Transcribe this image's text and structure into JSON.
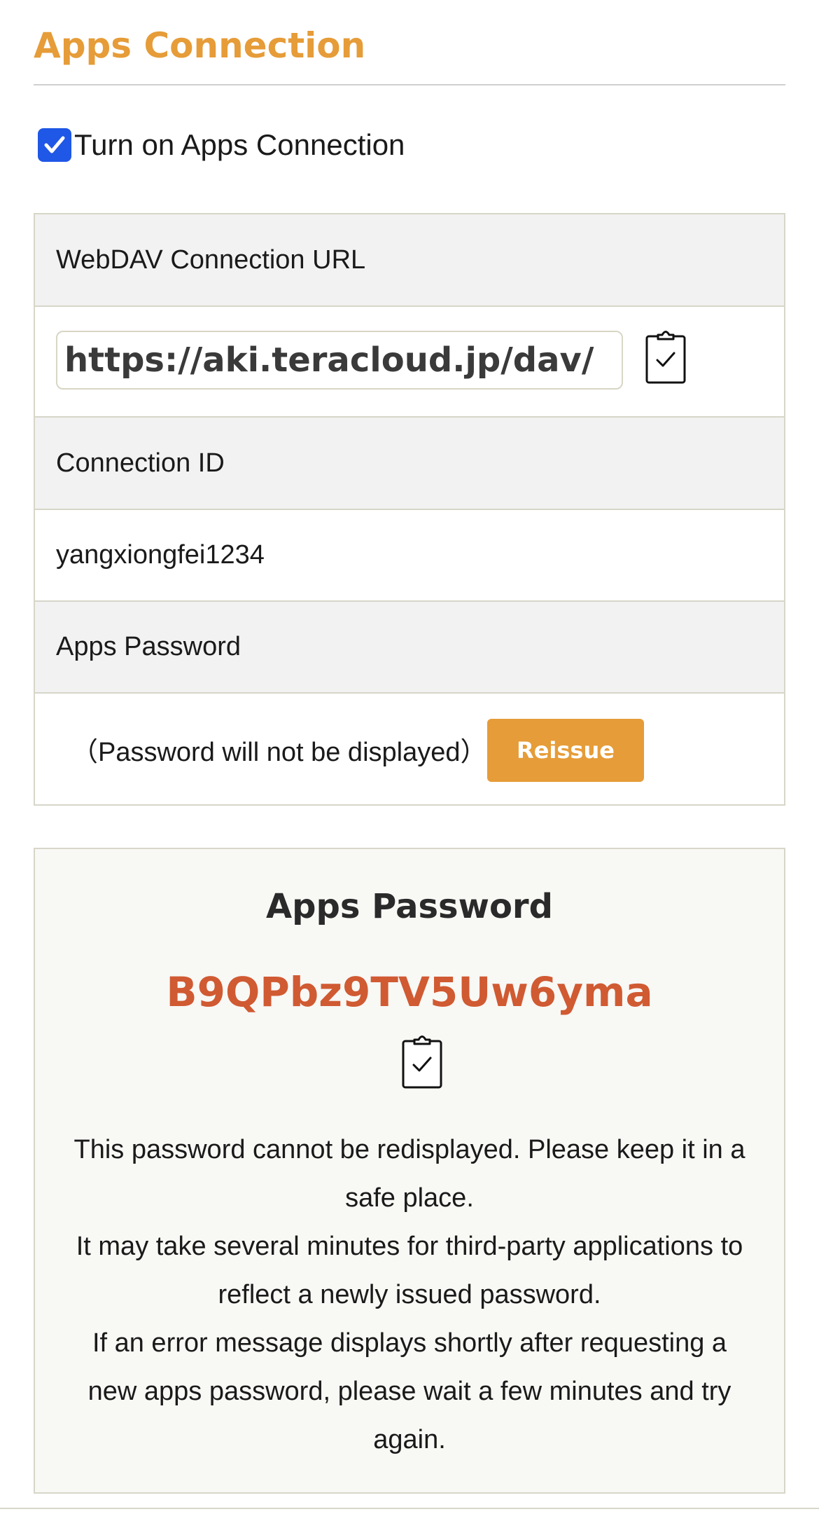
{
  "page": {
    "title": "Apps Connection"
  },
  "toggle": {
    "label": "Turn on Apps Connection",
    "checked": true
  },
  "webdav": {
    "label": "WebDAV Connection URL",
    "value": "https://aki.teracloud.jp/dav/",
    "copy_icon": "clipboard-check-icon"
  },
  "connection": {
    "label": "Connection ID",
    "value": "yangxiongfei1234"
  },
  "apps_password": {
    "label": "Apps Password",
    "note": "（Password will not be displayed）",
    "reissue_label": "Reissue"
  },
  "result": {
    "title": "Apps Password",
    "password": "B9QPbz9TV5Uw6yma",
    "copy_icon": "clipboard-check-icon",
    "messages": [
      "This password cannot be redisplayed. Please keep it in a safe place.",
      "It may take several minutes for third-party applications to reflect a newly issued password.",
      "If an error message displays shortly after requesting a new apps password, please wait a few minutes and try again."
    ]
  },
  "colors": {
    "accent": "#e69c38",
    "checkbox": "#1f57e6",
    "password": "#d05a32",
    "border": "#d7d6c9"
  }
}
